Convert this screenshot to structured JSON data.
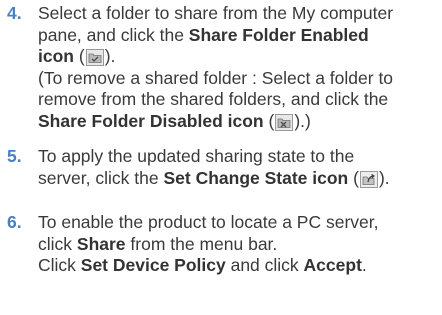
{
  "colors": {
    "step_number": "#4a7fc0",
    "text": "#3a3a3a"
  },
  "steps": [
    {
      "number": "4.",
      "l1": "Select a folder to share from the My computer",
      "l2a": "pane, and click the ",
      "l2b": "Share Folder Enabled",
      "l3a": "icon",
      "l3b": " (",
      "l3c": ").",
      "l4": "(To remove a shared folder : Select a folder to",
      "l5": "remove from the shared folders, and click the",
      "l6a": "Share Folder Disabled icon",
      "l6b": " (",
      "l6c": ").)",
      "icon_enabled": "share-folder-enabled-icon",
      "icon_disabled": "share-folder-disabled-icon"
    },
    {
      "number": "5.",
      "l1": "To apply the updated sharing state to the",
      "l2a": "server, click the ",
      "l2b": "Set Change State icon",
      "l2c": " (",
      "l2d": ").",
      "icon": "set-change-state-icon"
    },
    {
      "number": "6.",
      "l1": "To enable the product to locate a PC server,",
      "l2a": "click ",
      "l2b": "Share",
      "l2c": " from the menu bar.",
      "l3a": "Click ",
      "l3b": "Set Device Policy",
      "l3c": " and click ",
      "l3d": "Accept",
      "l3e": "."
    }
  ]
}
